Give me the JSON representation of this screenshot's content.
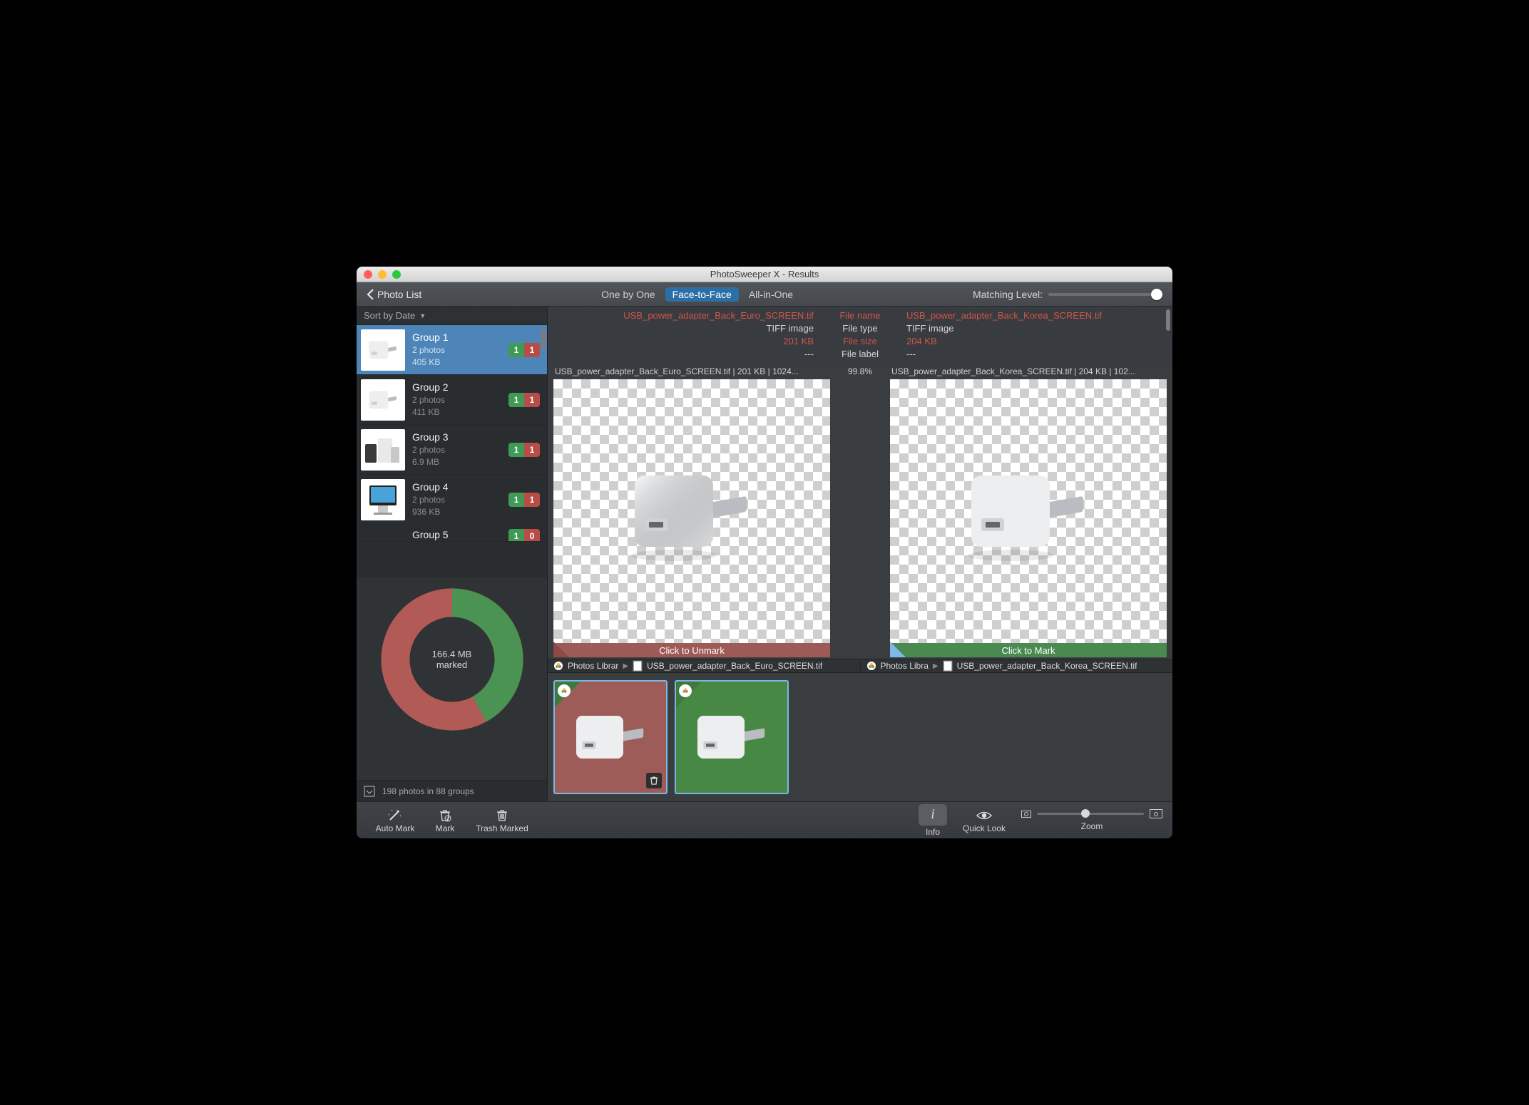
{
  "window": {
    "title": "PhotoSweeper X - Results"
  },
  "toolbar": {
    "back_label": "Photo List",
    "tabs": [
      "One by One",
      "Face-to-Face",
      "All-in-One"
    ],
    "active_tab": 1,
    "matching_label": "Matching Level:",
    "matching_value": 0.95
  },
  "sidebar": {
    "sort_label": "Sort by Date",
    "groups": [
      {
        "title": "Group 1",
        "sub1": "2 photos",
        "sub2": "405 KB",
        "green": "1",
        "red": "1",
        "selected": true
      },
      {
        "title": "Group 2",
        "sub1": "2 photos",
        "sub2": "411 KB",
        "green": "1",
        "red": "1",
        "selected": false
      },
      {
        "title": "Group 3",
        "sub1": "2 photos",
        "sub2": "6.9 MB",
        "green": "1",
        "red": "1",
        "selected": false
      },
      {
        "title": "Group 4",
        "sub1": "2 photos",
        "sub2": "936 KB",
        "green": "1",
        "red": "1",
        "selected": false
      },
      {
        "title": "Group 5",
        "sub1": "",
        "sub2": "",
        "green": "1",
        "red": "0",
        "selected": false,
        "cut": true
      }
    ],
    "donut": {
      "line1": "166.4 MB",
      "line2": "marked",
      "green_pct": 42,
      "red_pct": 58
    },
    "footer": "198 photos in 88 groups"
  },
  "meta": {
    "labels": [
      "File name",
      "File type",
      "File size",
      "File label"
    ],
    "highlight": [
      true,
      false,
      true,
      false
    ],
    "left": [
      "USB_power_adapter_Back_Euro_SCREEN.tif",
      "TIFF image",
      "201 KB",
      "---"
    ],
    "right": [
      "USB_power_adapter_Back_Korea_SCREEN.tif",
      "TIFF image",
      "204 KB",
      "---"
    ]
  },
  "preview": {
    "left_caption": "USB_power_adapter_Back_Euro_SCREEN.tif | 201 KB | 1024...",
    "similarity": "99.8%",
    "right_caption": "USB_power_adapter_Back_Korea_SCREEN.tif | 204 KB | 102...",
    "left_bar": "Click to Unmark",
    "right_bar": "Click to Mark"
  },
  "breadcrumb": {
    "left": {
      "root": "Photos Librar",
      "file": "USB_power_adapter_Back_Euro_SCREEN.tif"
    },
    "right": {
      "root": "Photos Libra",
      "file": "USB_power_adapter_Back_Korea_SCREEN.tif"
    }
  },
  "bottom": {
    "auto_mark": "Auto Mark",
    "mark": "Mark",
    "trash_marked": "Trash Marked",
    "info": "Info",
    "quick_look": "Quick Look",
    "zoom": "Zoom",
    "zoom_value": 0.45
  },
  "colors": {
    "green": "#3e9b4b",
    "red": "#b84f4b"
  }
}
